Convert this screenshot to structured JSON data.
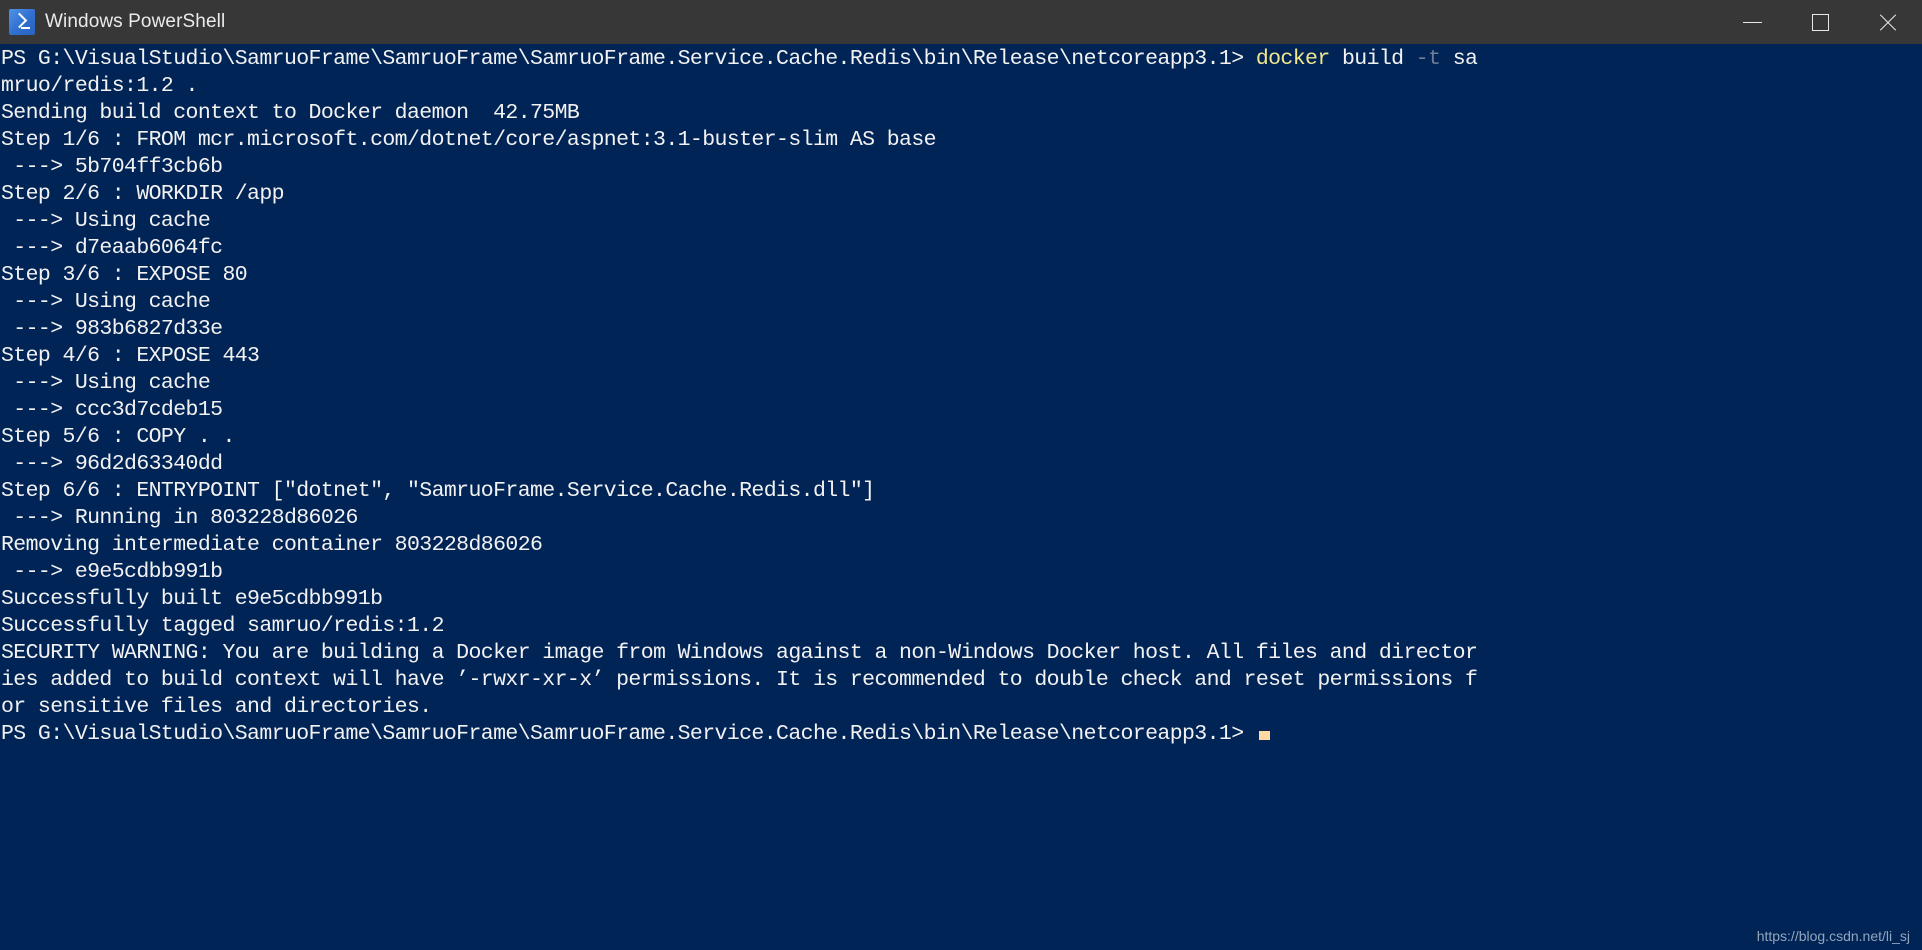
{
  "window": {
    "title": "Windows PowerShell",
    "app_icon": "powershell-icon",
    "titlebar_color": "#373737",
    "console_background": "#012456",
    "console_foreground": "#f2f2f2",
    "command_color": "#f0e68c",
    "parameter_color": "#6e7f96",
    "cursor_color": "#ffd9a0",
    "controls": [
      {
        "name": "minimize-button",
        "glyph": "minimize-icon",
        "label": "—"
      },
      {
        "name": "maximize-button",
        "glyph": "maximize-icon",
        "label": "□"
      },
      {
        "name": "close-button",
        "glyph": "close-icon",
        "label": "✕"
      }
    ]
  },
  "console": {
    "lines": [
      {
        "segments": [
          {
            "text": "PS G:\\VisualStudio\\SamruoFrame\\SamruoFrame\\SamruoFrame.Service.Cache.Redis\\bin\\Release\\netcoreapp3.1> ",
            "style": "default"
          },
          {
            "text": "docker",
            "style": "command"
          },
          {
            "text": " build ",
            "style": "default"
          },
          {
            "text": "-t",
            "style": "param"
          },
          {
            "text": " sa",
            "style": "default"
          }
        ]
      },
      {
        "segments": [
          {
            "text": "mruo/redis:1.2 .",
            "style": "default"
          }
        ]
      },
      {
        "segments": [
          {
            "text": "Sending build context to Docker daemon  42.75MB",
            "style": "default"
          }
        ]
      },
      {
        "segments": [
          {
            "text": "Step 1/6 : FROM mcr.microsoft.com/dotnet/core/aspnet:3.1-buster-slim AS base",
            "style": "default"
          }
        ]
      },
      {
        "segments": [
          {
            "text": " ---> 5b704ff3cb6b",
            "style": "default"
          }
        ]
      },
      {
        "segments": [
          {
            "text": "Step 2/6 : WORKDIR /app",
            "style": "default"
          }
        ]
      },
      {
        "segments": [
          {
            "text": " ---> Using cache",
            "style": "default"
          }
        ]
      },
      {
        "segments": [
          {
            "text": " ---> d7eaab6064fc",
            "style": "default"
          }
        ]
      },
      {
        "segments": [
          {
            "text": "Step 3/6 : EXPOSE 80",
            "style": "default"
          }
        ]
      },
      {
        "segments": [
          {
            "text": " ---> Using cache",
            "style": "default"
          }
        ]
      },
      {
        "segments": [
          {
            "text": " ---> 983b6827d33e",
            "style": "default"
          }
        ]
      },
      {
        "segments": [
          {
            "text": "Step 4/6 : EXPOSE 443",
            "style": "default"
          }
        ]
      },
      {
        "segments": [
          {
            "text": " ---> Using cache",
            "style": "default"
          }
        ]
      },
      {
        "segments": [
          {
            "text": " ---> ccc3d7cdeb15",
            "style": "default"
          }
        ]
      },
      {
        "segments": [
          {
            "text": "Step 5/6 : COPY . .",
            "style": "default"
          }
        ]
      },
      {
        "segments": [
          {
            "text": " ---> 96d2d63340dd",
            "style": "default"
          }
        ]
      },
      {
        "segments": [
          {
            "text": "Step 6/6 : ENTRYPOINT [″dotnet″, ″SamruoFrame.Service.Cache.Redis.dll″]",
            "style": "default"
          }
        ]
      },
      {
        "segments": [
          {
            "text": " ---> Running in 803228d86026",
            "style": "default"
          }
        ]
      },
      {
        "segments": [
          {
            "text": "Removing intermediate container 803228d86026",
            "style": "default"
          }
        ]
      },
      {
        "segments": [
          {
            "text": " ---> e9e5cdbb991b",
            "style": "default"
          }
        ]
      },
      {
        "segments": [
          {
            "text": "Successfully built e9e5cdbb991b",
            "style": "default"
          }
        ]
      },
      {
        "segments": [
          {
            "text": "Successfully tagged samruo/redis:1.2",
            "style": "default"
          }
        ]
      },
      {
        "segments": [
          {
            "text": "SECURITY WARNING: You are building a Docker image from Windows against a non-Windows Docker host. All files and director",
            "style": "default"
          }
        ]
      },
      {
        "segments": [
          {
            "text": "ies added to build context will have ’-rwxr-xr-x’ permissions. It is recommended to double check and reset permissions f",
            "style": "default"
          }
        ]
      },
      {
        "segments": [
          {
            "text": "or sensitive files and directories.",
            "style": "default"
          }
        ]
      },
      {
        "segments": [
          {
            "text": "PS G:\\VisualStudio\\SamruoFrame\\SamruoFrame\\SamruoFrame.Service.Cache.Redis\\bin\\Release\\netcoreapp3.1> ",
            "style": "default"
          }
        ],
        "cursor": true
      }
    ]
  },
  "watermark": {
    "text": "https://blog.csdn.net/li_sj"
  }
}
